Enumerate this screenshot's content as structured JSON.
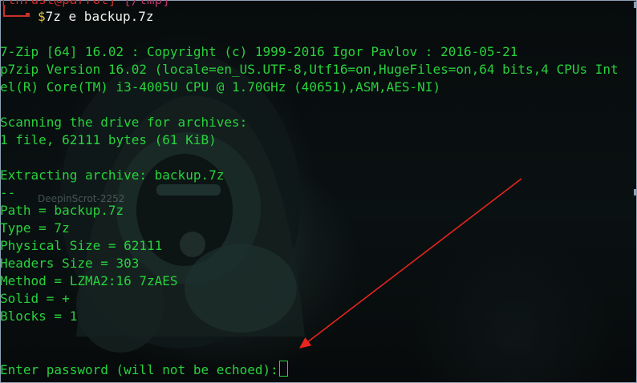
{
  "prompt": {
    "user_host": "[thrust@parrot",
    "dir": "[/tmp]"
  },
  "command": {
    "dollar": "$",
    "text": "7z e backup.7z"
  },
  "output": {
    "header1": "7-Zip [64] 16.02 : Copyright (c) 1999-2016 Igor Pavlov : 2016-05-21",
    "header2": "p7zip Version 16.02 (locale=en_US.UTF-8,Utf16=on,HugeFiles=on,64 bits,4 CPUs Int",
    "header3": "el(R) Core(TM) i3-4005U CPU @ 1.70GHz (40651),ASM,AES-NI)",
    "scanning": "Scanning the drive for archives:",
    "file_count": "1 file, 62111 bytes (61 KiB)",
    "extracting": "Extracting archive: backup.7z",
    "separator": "--",
    "path": "Path = backup.7z",
    "type": "Type = 7z",
    "physical_size": "Physical Size = 62111",
    "headers_size": "Headers Size = 303",
    "method": "Method = LZMA2:16 7zAES",
    "solid": "Solid = +",
    "blocks": "Blocks = 1",
    "password_prompt": "Enter password (will not be echoed):"
  },
  "overlay": {
    "ghost_label": "DeepinScrot-2252",
    "arrow_color": "#e8241e"
  },
  "colors": {
    "output_text": "#28d23c",
    "prompt_red": "#c8302a",
    "dollar": "#e7c33a",
    "command_text": "#f1f1ec"
  }
}
